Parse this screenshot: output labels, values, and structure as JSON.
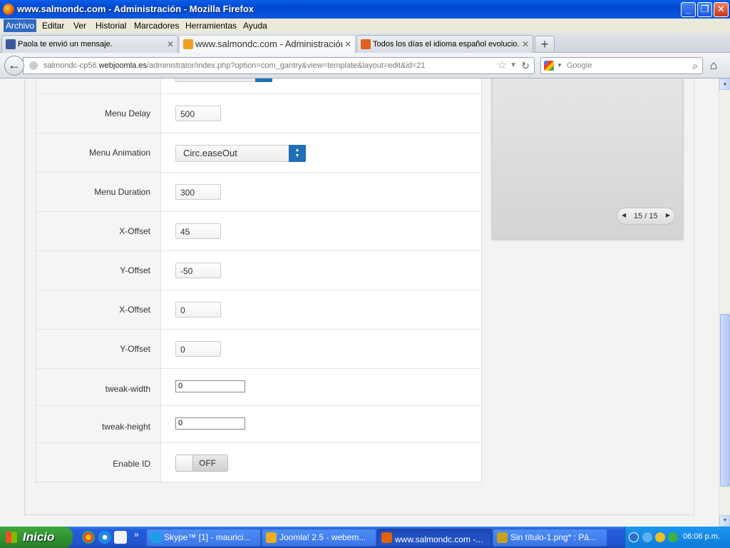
{
  "window": {
    "title": "www.salmondc.com - Administración - Mozilla Firefox",
    "minimize": "_",
    "maximize": "❐",
    "close": "✕"
  },
  "menu": [
    "Archivo",
    "Editar",
    "Ver",
    "Historial",
    "Marcadores",
    "Herramientas",
    "Ayuda"
  ],
  "tabs": [
    {
      "label": "Paola te envió un mensaje.",
      "icon_color": "#3b5998"
    },
    {
      "label": "www.salmondc.com - Administración",
      "icon_color": "#f0a020"
    },
    {
      "label": "Todos los días el idioma español evolucio...",
      "icon_color": "#e06020"
    }
  ],
  "tab_close": "✕",
  "new_tab": "+",
  "address": {
    "prefix": "salmondc-cp56.",
    "domain": "webjoomla.es",
    "path": "/administrator/index.php?option=com_gantry&view=template&layout=edit&id=21"
  },
  "search": {
    "placeholder": "Google"
  },
  "form": {
    "rows": [
      {
        "label": "Menu Delay",
        "type": "small",
        "value": "500"
      },
      {
        "label": "Menu Animation",
        "type": "select",
        "value": "Circ.easeOut"
      },
      {
        "label": "Menu Duration",
        "type": "small",
        "value": "300"
      },
      {
        "label": "X-Offset",
        "type": "small",
        "value": "45"
      },
      {
        "label": "Y-Offset",
        "type": "small",
        "value": "-50"
      },
      {
        "label": "X-Offset",
        "type": "small",
        "value": "0"
      },
      {
        "label": "Y-Offset",
        "type": "small",
        "value": "0"
      },
      {
        "label": "tweak-width",
        "type": "wide",
        "value": "0"
      },
      {
        "label": "tweak-height",
        "type": "wide",
        "value": "0"
      },
      {
        "label": "Enable ID",
        "type": "toggle",
        "value": "OFF"
      }
    ]
  },
  "preview": {
    "pager": "15 / 15",
    "prev": "◀",
    "next": "▶"
  },
  "taskbar": {
    "start": "Inicio",
    "more": "»",
    "buttons": [
      {
        "label": "Skype™ [1] - maurici...",
        "icon_color": "#1aa0e8"
      },
      {
        "label": "Joomla! 2.5 - webem...",
        "icon_color": "#e8b020"
      },
      {
        "label": "www.salmondc.com -...",
        "icon_color": "#e2620a"
      },
      {
        "label": "Sin título-1.png* : Pá...",
        "icon_color": "#c8a020"
      }
    ],
    "clock": "06:06 p.m."
  }
}
